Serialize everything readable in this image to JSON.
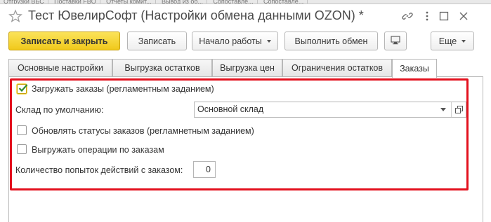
{
  "window": {
    "title": "Тест ЮвелирСофт (Настройки обмена данными OZON) *",
    "background_tabs": [
      "Отгрузки ВБС",
      "Поставки FBO",
      "Отчеты комит...",
      "Вывод из об...",
      "Сопоставле...",
      "Сопоставле..."
    ]
  },
  "toolbar": {
    "save_close": "Записать и закрыть",
    "save": "Записать",
    "start_work": "Начало работы",
    "run_exchange": "Выполнить обмен",
    "more": "Еще"
  },
  "tabs": [
    {
      "label": "Основные настройки"
    },
    {
      "label": "Выгрузка остатков"
    },
    {
      "label": "Выгрузка цен"
    },
    {
      "label": "Ограничения остатков"
    },
    {
      "label": "Заказы"
    }
  ],
  "orders": {
    "load_orders": {
      "label": "Загружать заказы (регламентным заданием)",
      "checked": true
    },
    "default_warehouse": {
      "label": "Склад по умолчанию:",
      "value": "Основной склад"
    },
    "update_statuses": {
      "label": "Обновлять статусы заказов (регламнетным заданием)",
      "checked": false
    },
    "export_operations": {
      "label": "Выгружать операции по заказам",
      "checked": false
    },
    "attempts": {
      "label": "Количество попыток действий с заказом:",
      "value": "0"
    }
  },
  "colors": {
    "accent_yellow": "#f0c91b",
    "highlight_red": "#e3101d",
    "check_green": "#2e8b2e"
  },
  "icons": [
    "star-icon",
    "link-icon",
    "more-vert-icon",
    "maximize-icon",
    "close-icon",
    "screen-icon",
    "dropdown-arrow-icon",
    "open-form-icon",
    "checkmark-icon"
  ]
}
